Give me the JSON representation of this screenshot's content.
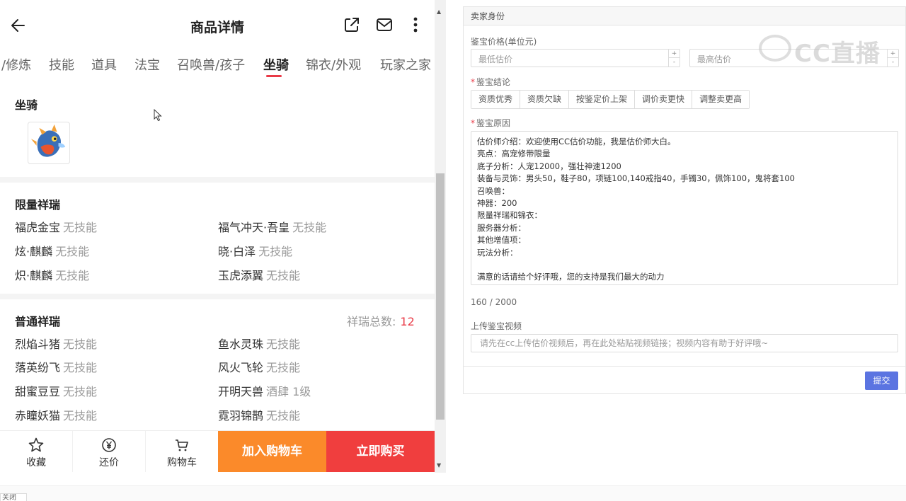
{
  "phone": {
    "title": "商品详情",
    "tabs": [
      "/修炼",
      "技能",
      "道具",
      "法宝",
      "召唤兽/孩子",
      "坐骑",
      "锦衣/外观",
      "玩家之家"
    ],
    "active_tab": "坐骑",
    "mount_section": {
      "title": "坐骑",
      "image_icon": "dragon-mount-icon"
    },
    "limited": {
      "title": "限量祥瑞",
      "items": [
        {
          "name": "福虎金宝",
          "skill": "无技能"
        },
        {
          "name": "福气冲天·吾皇",
          "skill": "无技能"
        },
        {
          "name": "炫·麒麟",
          "skill": "无技能"
        },
        {
          "name": "晓·白泽",
          "skill": "无技能"
        },
        {
          "name": "炽·麒麟",
          "skill": "无技能"
        },
        {
          "name": "玉虎添翼",
          "skill": "无技能"
        }
      ]
    },
    "normal": {
      "title": "普通祥瑞",
      "total_label": "祥瑞总数:",
      "total": "12",
      "items": [
        {
          "name": "烈焰斗猪",
          "skill": "无技能"
        },
        {
          "name": "鱼水灵珠",
          "skill": "无技能"
        },
        {
          "name": "落英纷飞",
          "skill": "无技能"
        },
        {
          "name": "风火飞轮",
          "skill": "无技能"
        },
        {
          "name": "甜蜜豆豆",
          "skill": "无技能"
        },
        {
          "name": "开明天兽",
          "skill": "酒肆 1级"
        },
        {
          "name": "赤瞳妖猫",
          "skill": "无技能"
        },
        {
          "name": "霓羽锦鹊",
          "skill": "无技能"
        }
      ]
    },
    "bottom": {
      "favorite": "收藏",
      "counter_offer": "还价",
      "cart": "购物车",
      "add_cart": "加入购物车",
      "buy_now": "立即购买"
    }
  },
  "form": {
    "header": "卖家身份",
    "price_label": "鉴宝价格(单位元)",
    "min_placeholder": "最低估价",
    "max_placeholder": "最高估价",
    "conclusion_label": "鉴宝结论",
    "conclusion_options": [
      "资质优秀",
      "资质欠缺",
      "按鉴定价上架",
      "调价卖更快",
      "调整卖更高"
    ],
    "reason_label": "鉴宝原因",
    "reason_text": "估价师介绍：欢迎使用CC估价功能，我是估价师大白。\n亮点：高宠修带限量\n底子分析：人宠12000，强壮神速1200\n装备与灵饰：男头50，鞋子80，项链100,140戒指40，手镯30，佩饰100，鬼将套100\n召唤兽：\n神器：200\n限量祥瑞和锦衣：\n服务器分析：\n其他增值项：\n玩法分析：\n\n满意的话请给个好评哦，您的支持是我们最大的动力",
    "char_count": "160 / 2000",
    "video_label": "上传鉴宝视频",
    "video_placeholder": "请先在cc上传估价视频后，再在此处粘贴视频链接；视频内容有助于好评哦~",
    "submit": "提交"
  },
  "watermark": "CC直播",
  "close_tab": "关闭"
}
